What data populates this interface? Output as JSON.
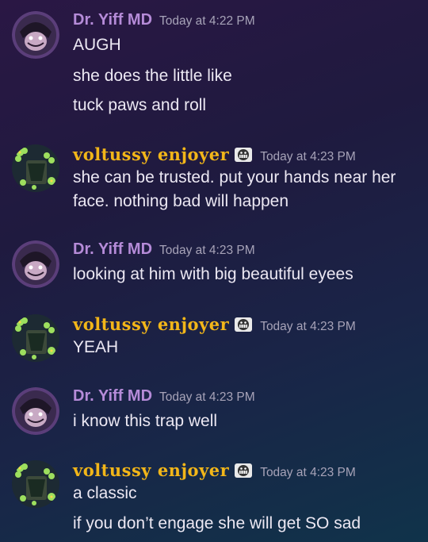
{
  "users": {
    "yiff": {
      "name": "Dr. Yiff MD",
      "name_color": "#b58bd8",
      "avatar": "purple-portrait-avatar"
    },
    "volt": {
      "name": "voltussy enjoyer",
      "name_color": "#f2b619",
      "avatar": "clover-plant-avatar",
      "badge": "skull-grin-badge"
    }
  },
  "groups": [
    {
      "author": "Dr. Yiff MD",
      "timestamp": "Today at 4:22 PM",
      "lines": [
        "AUGH",
        "she does the little like",
        "tuck paws and roll"
      ]
    },
    {
      "author": "voltussy enjoyer",
      "timestamp": "Today at 4:23 PM",
      "lines": [
        "she can be trusted. put your hands near her",
        "face. nothing bad will happen"
      ]
    },
    {
      "author": "Dr. Yiff MD",
      "timestamp": "Today at 4:23 PM",
      "lines": [
        "looking at him with big beautiful eyees"
      ]
    },
    {
      "author": "voltussy enjoyer",
      "timestamp": "Today at 4:23 PM",
      "lines": [
        "YEAH"
      ]
    },
    {
      "author": "Dr. Yiff MD",
      "timestamp": "Today at 4:23 PM",
      "lines": [
        "i know this trap well"
      ]
    },
    {
      "author": "voltussy enjoyer",
      "timestamp": "Today at 4:23 PM",
      "lines": [
        "a classic",
        "if you don’t engage she will get SO sad"
      ]
    }
  ]
}
